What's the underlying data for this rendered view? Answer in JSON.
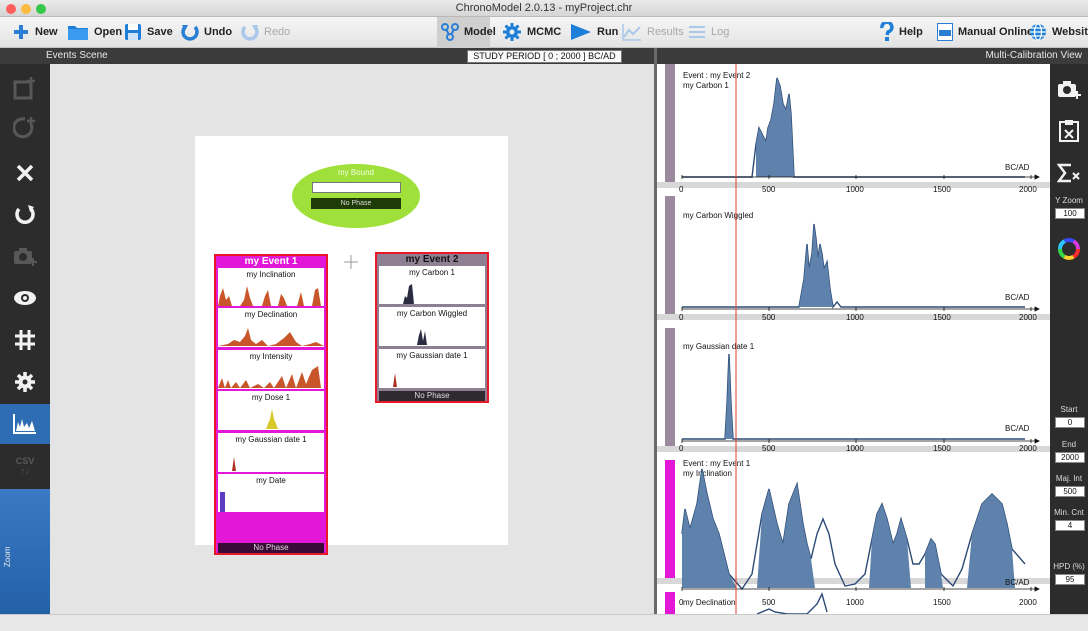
{
  "window": {
    "title": "ChronoModel 2.0.13 - myProject.chr"
  },
  "toolbar": {
    "new": "New",
    "open": "Open",
    "save": "Save",
    "undo": "Undo",
    "redo": "Redo",
    "model": "Model",
    "mcmc": "MCMC",
    "run": "Run",
    "results": "Results",
    "log": "Log",
    "help": "Help",
    "manual": "Manual Online",
    "website": "Website"
  },
  "scene": {
    "header": "Events Scene",
    "study_period": "STUDY PERIOD [ 0 ; 2000 ] BC/AD",
    "bound": {
      "title": "my Bound",
      "phase": "No Phase",
      "color": "#9fe03a"
    },
    "event1": {
      "title": "my Event 1",
      "color": "#e317d7",
      "dates": [
        "my Inclination",
        "my Declination",
        "my Intensity",
        "my Dose 1",
        "my Gaussian date 1",
        "my Date"
      ],
      "phase": "No Phase"
    },
    "event2": {
      "title": "my Event 2",
      "color": "#8e7f92",
      "dates": [
        "my Carbon 1",
        "my Carbon Wiggled",
        "my Gaussian date 1"
      ],
      "phase": "No Phase"
    }
  },
  "left_tools": {
    "icons": [
      "add-event-icon",
      "add-bound-icon",
      "delete-icon",
      "restore-icon",
      "export-image-icon",
      "view-icon",
      "grid-icon",
      "settings-icon",
      "proxy-icon",
      "csv-export-icon"
    ],
    "zoom_label": "Zoom",
    "csv_label": "CSV"
  },
  "calibration": {
    "header": "Multi-Calibration View",
    "axis_unit": "BC/AD",
    "ticks": [
      "0",
      "500",
      "1000",
      "1500",
      "2000"
    ],
    "plots": [
      {
        "lines": [
          "Event : my Event 2",
          "my Carbon 1"
        ],
        "color": "#9b8a9e"
      },
      {
        "lines": [
          "my Carbon Wiggled"
        ],
        "color": "#9b8a9e"
      },
      {
        "lines": [
          "my Gaussian date 1"
        ],
        "color": "#9b8a9e"
      },
      {
        "lines": [
          "Event : my Event 1",
          "my Inclination"
        ],
        "color": "#e317d7"
      },
      {
        "lines": [
          "my Declination"
        ],
        "color": "#e317d7"
      }
    ]
  },
  "right_panel": {
    "y_zoom_label": "Y Zoom",
    "y_zoom": "100",
    "start_label": "Start",
    "start": "0",
    "end_label": "End",
    "end": "2000",
    "maj_label": "Maj. Int",
    "maj": "500",
    "min_label": "Min. Cnt",
    "min": "4",
    "hpd_label": "HPD (%)",
    "hpd": "95"
  }
}
